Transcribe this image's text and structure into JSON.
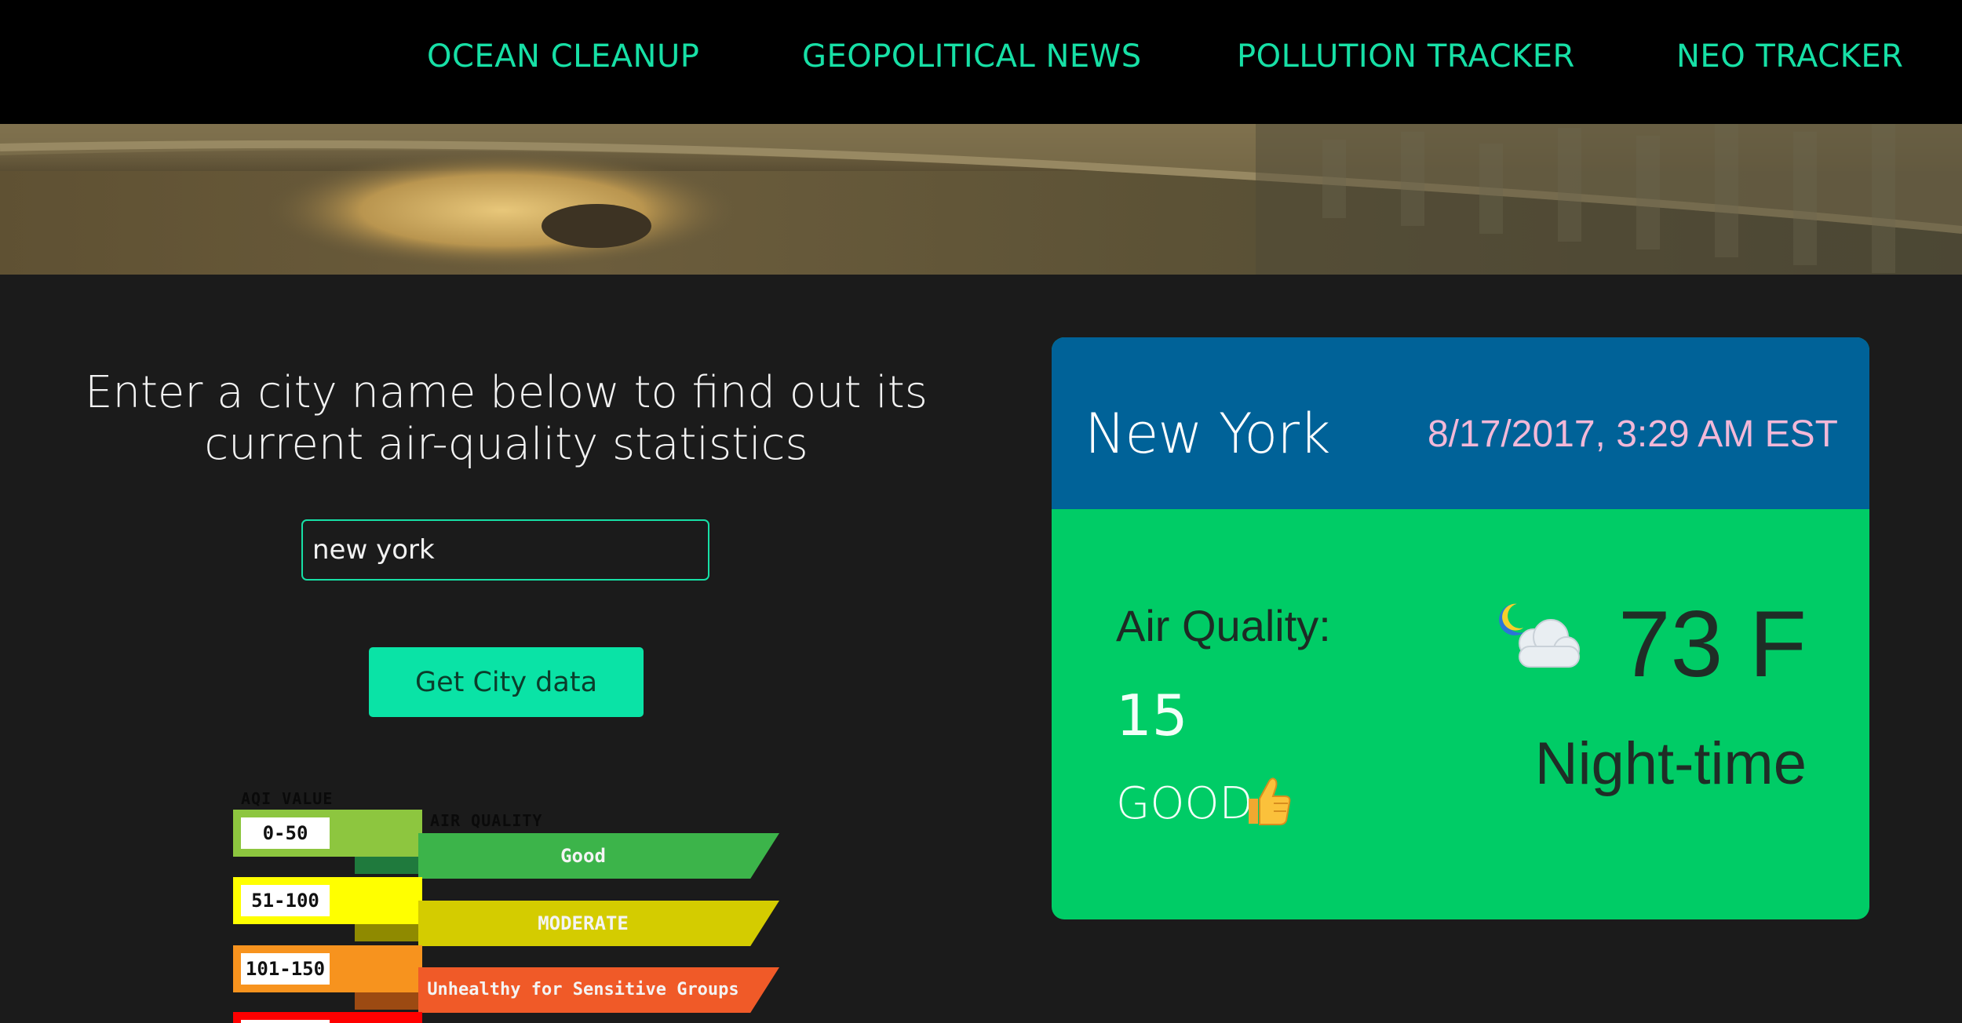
{
  "nav": {
    "items": [
      {
        "label": "OCEAN CLEANUP"
      },
      {
        "label": "GEOPOLITICAL NEWS"
      },
      {
        "label": "POLLUTION TRACKER"
      },
      {
        "label": "NEO TRACKER"
      }
    ]
  },
  "search": {
    "intro": "Enter a city name below to find out its current air-quality statistics",
    "input_value": "new york",
    "button_label": "Get City data"
  },
  "aqi_legend": {
    "value_header": "AQI VALUE",
    "quality_header": "AIR QUALITY",
    "rows": [
      {
        "range": "0-50",
        "quality": "Good",
        "color": "#8dc63f",
        "band_color": "#3cb44a"
      },
      {
        "range": "51-100",
        "quality": "MODERATE",
        "color": "#ffff00",
        "band_color": "#d4cc00"
      },
      {
        "range": "101-150",
        "quality": "Unhealthy for Sensitive Groups",
        "color": "#f7931e",
        "band_color": "#f05a28"
      },
      {
        "range": "",
        "quality": "",
        "color": "#ff0000",
        "band_color": "#d81e1e"
      }
    ]
  },
  "weather_card": {
    "city": "New York",
    "timestamp": "8/17/2017, 3:29 AM EST",
    "air_quality_label": "Air Quality:",
    "aqi_value": "15",
    "status": "GOOD",
    "status_icon": "thumbs-up-icon",
    "weather_icon": "moon-cloud-icon",
    "temperature": "73 F",
    "daypart": "Night-time",
    "colors": {
      "header": "#006298",
      "body": "#00cc66"
    }
  }
}
